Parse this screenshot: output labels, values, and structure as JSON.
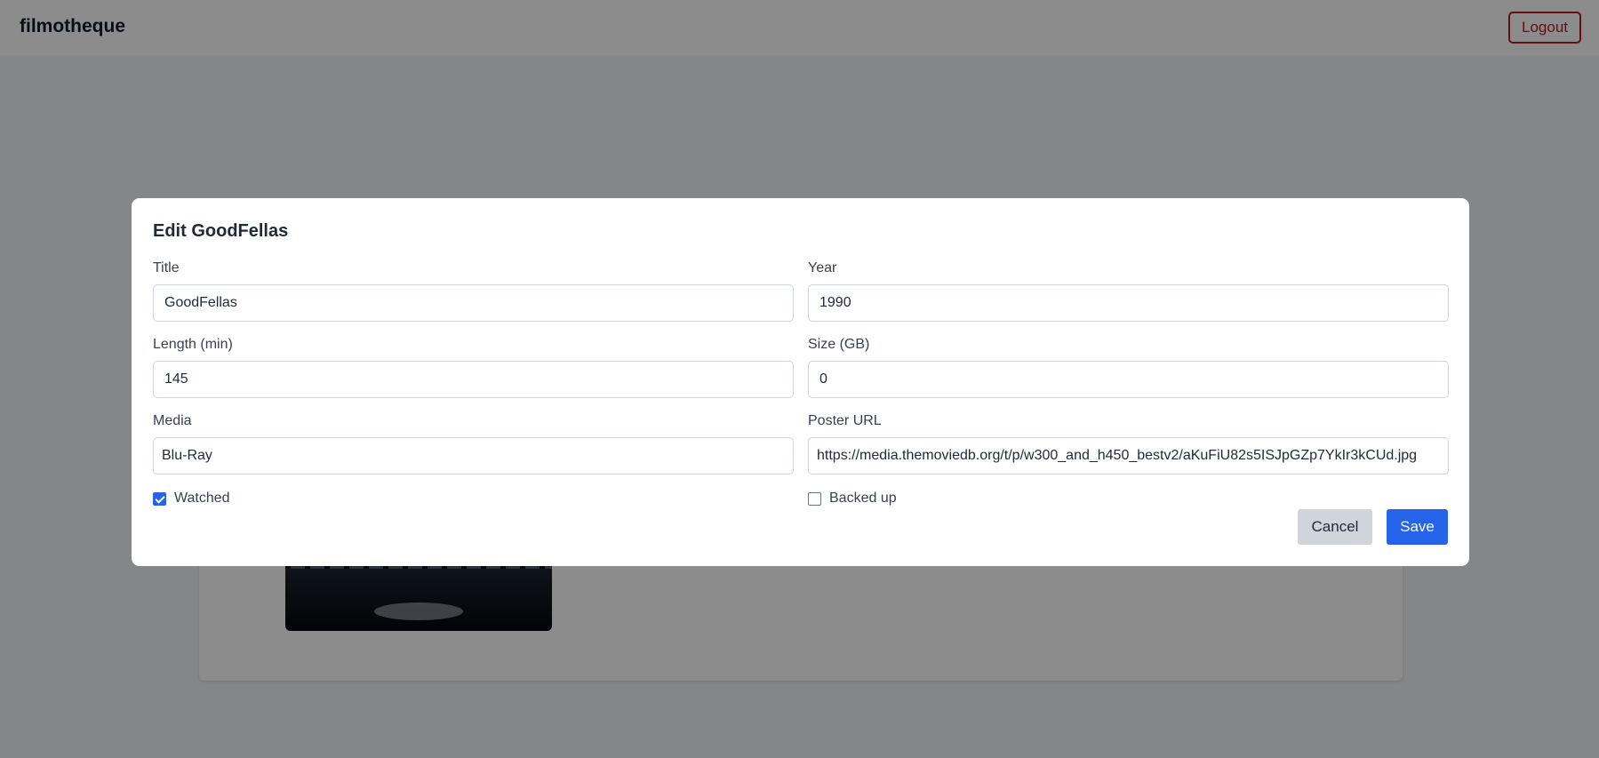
{
  "app": {
    "brand": "filmotheque",
    "logout_label": "Logout"
  },
  "modal": {
    "title": "Edit GoodFellas",
    "fields": {
      "title": {
        "label": "Title",
        "value": "GoodFellas"
      },
      "year": {
        "label": "Year",
        "value": "1990"
      },
      "length": {
        "label": "Length (min)",
        "value": "145"
      },
      "size": {
        "label": "Size (GB)",
        "value": "0"
      },
      "media": {
        "label": "Media",
        "value": "Blu-Ray"
      },
      "poster_url": {
        "label": "Poster URL",
        "value": "https://media.themoviedb.org/t/p/w300_and_h450_bestv2/aKuFiU82s5ISJpGZp7YkIr3kCUd.jpg"
      }
    },
    "checkboxes": {
      "watched": {
        "label": "Watched",
        "checked": true
      },
      "backed_up": {
        "label": "Backed up",
        "checked": false
      }
    },
    "cancel_label": "Cancel",
    "save_label": "Save"
  },
  "colors": {
    "primary": "#2563eb",
    "danger": "#b91c1c",
    "secondary_button": "#d1d5db",
    "overlay": "rgba(0,0,0,0.45)"
  }
}
